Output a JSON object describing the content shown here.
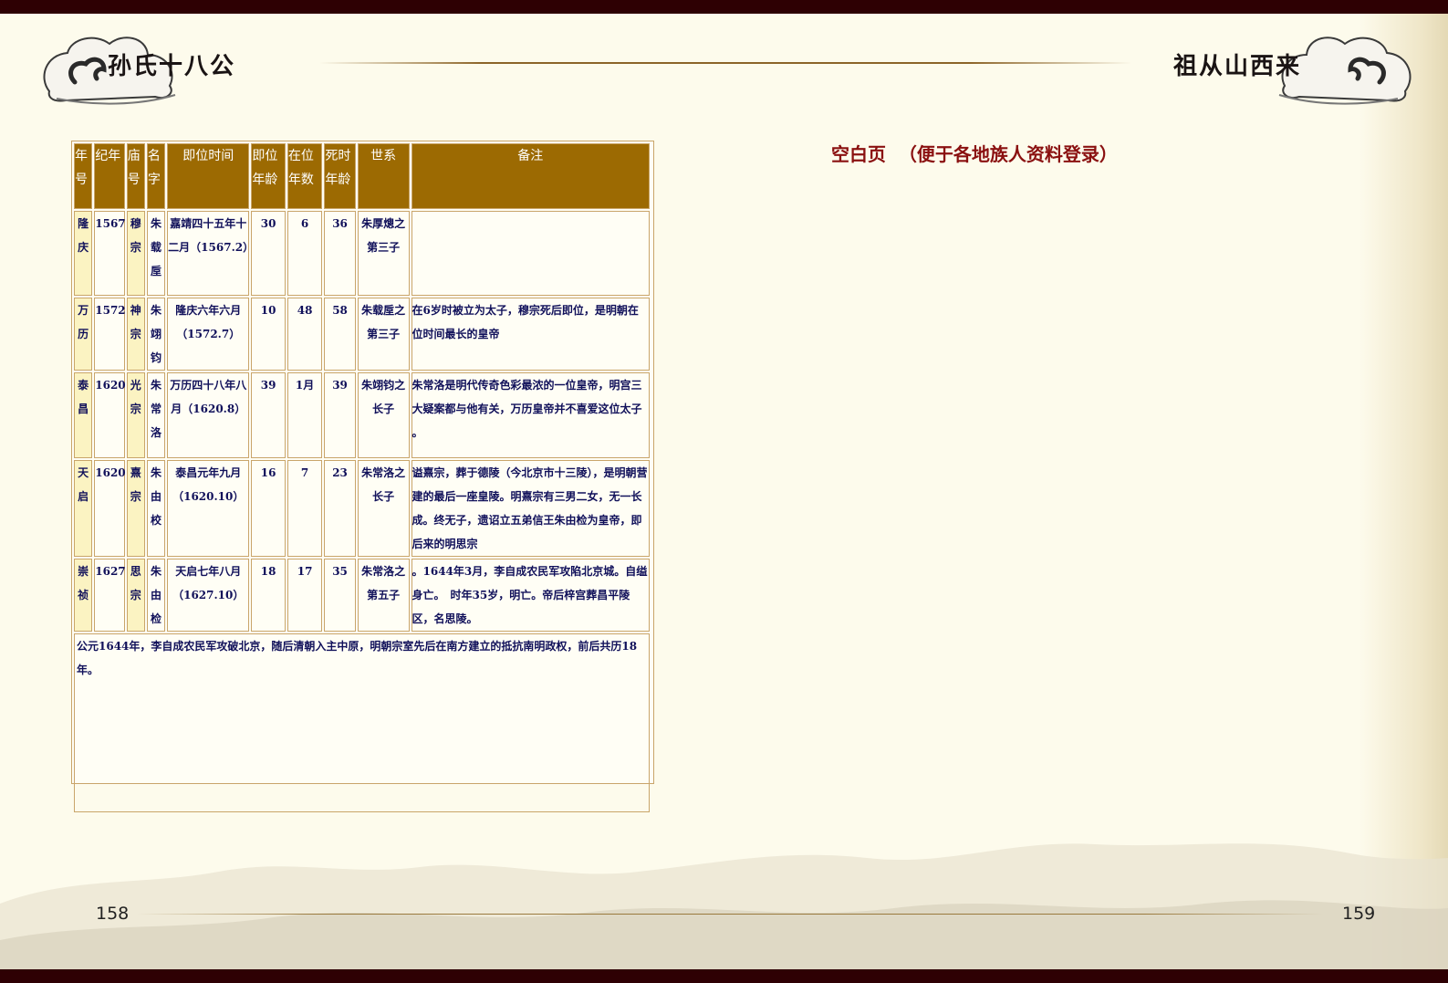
{
  "header": {
    "left_title": "孙氏十八公",
    "right_title": "祖从山西来"
  },
  "footer": {
    "left_page": "158",
    "right_page": "159"
  },
  "blank_page_title": "空白页  （便于各地族人资料登录）",
  "table": {
    "headers": {
      "era": "年号",
      "year": "纪年",
      "temple": "庙号",
      "name": "名字",
      "accession": "即位时间",
      "age_acc": "即位年龄",
      "years": "在位年数",
      "age_death": "死时年龄",
      "lineage": "世系",
      "notes": "备注"
    },
    "rows": [
      {
        "era": "隆庆",
        "year": "1567",
        "temple": "穆宗",
        "name": "朱载垕",
        "accession": "嘉靖四十五年十二月（1567.2）",
        "age_acc": "30",
        "years": "6",
        "age_death": "36",
        "lineage": "朱厚熜之第三子",
        "notes": ""
      },
      {
        "era": "万历",
        "year": "1572",
        "temple": "神宗",
        "name": "朱翊钧",
        "accession": "隆庆六年六月（1572.7）",
        "age_acc": "10",
        "years": "48",
        "age_death": "58",
        "lineage": "朱载垕之第三子",
        "notes": "在6岁时被立为太子，穆宗死后即位，是明朝在位时间最长的皇帝"
      },
      {
        "era": "泰昌",
        "year": "1620",
        "temple": "光宗",
        "name": "朱常洛",
        "accession": "万历四十八年八月（1620.8）",
        "age_acc": "39",
        "years": "1月",
        "age_death": "39",
        "lineage": "朱翊钧之长子",
        "notes": "朱常洛是明代传奇色彩最浓的一位皇帝，明宫三大疑案都与他有关，万历皇帝并不喜爱这位太子 。"
      },
      {
        "era": "天启",
        "year": "1620",
        "temple": "熹宗",
        "name": "朱由校",
        "accession": "泰昌元年九月（1620.10）",
        "age_acc": "16",
        "years": "7",
        "age_death": "23",
        "lineage": "朱常洛之长子",
        "notes": "谥熹宗，葬于德陵（今北京市十三陵），是明朝营建的最后一座皇陵。明熹宗有三男二女，无一长成。终无子，遗诏立五弟信王朱由检为皇帝，即后来的明思宗"
      },
      {
        "era": "崇祯",
        "year": "1627",
        "temple": "思宗",
        "name": "朱由检",
        "accession": "天启七年八月（1627.10）",
        "age_acc": "18",
        "years": "17",
        "age_death": "35",
        "lineage": "朱常洛之第五子",
        "notes": "。1644年3月，李自成农民军攻陷北京城。自缢身亡。　时年35岁，明亡。帝后梓宫葬昌平陵区，名思陵。"
      }
    ],
    "footer_note": "公元1644年，李自成农民军攻破北京，随后清朝入主中原，明朝宗室先后在南方建立的抵抗南明政权，前后共历18年。"
  }
}
